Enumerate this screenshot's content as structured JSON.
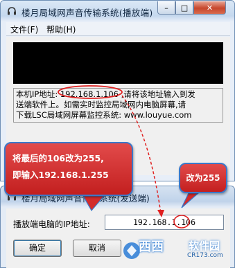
{
  "top_window": {
    "title": "楼月局域网声音传输系统(播放端)",
    "menu": [
      "文件(F)",
      "帮助(H)"
    ],
    "info_lines": [
      "本机IP地址: 192.168.1.106 ,请将该地址输入到发",
      "送端软件上。如需实时监控局域网内电脑屏幕,请",
      "下载LSC局域网屏幕监控系统: www.louyue.com"
    ]
  },
  "bottom_window": {
    "title": "楼月局域网声音传输系统(发送端)",
    "ip_label": "播放端电脑的IP地址:",
    "ip_value": "192.168.1.106",
    "ok_label": "确定",
    "cancel_label": "取消"
  },
  "annotations": {
    "bubble_main_line1": "将最后的106改为255,",
    "bubble_main_line2": "即输入192.168.1.255",
    "bubble_small": "改为255",
    "color_bubble": "#d32b2b",
    "color_outline": "#3b78c9",
    "color_arrow": "#e02020"
  },
  "watermark": {
    "brand": "西西",
    "brand2": "软件园",
    "site": "CR173.com"
  },
  "icons": [
    "headphone-icon",
    "minimize-icon",
    "maximize-icon",
    "close-icon"
  ]
}
